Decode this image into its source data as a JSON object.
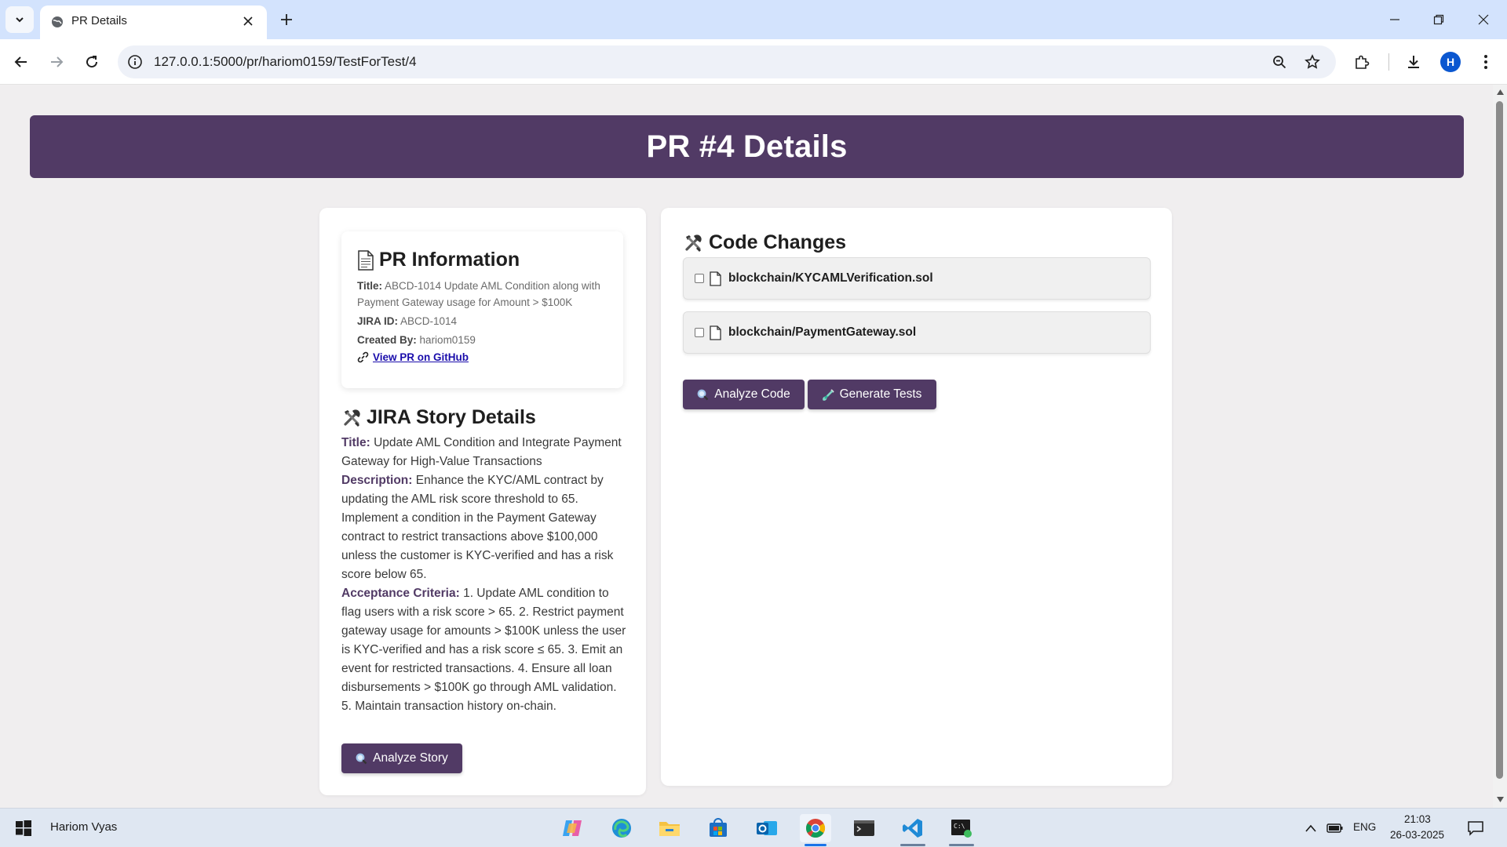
{
  "browser": {
    "tab_title": "PR Details",
    "url": "127.0.0.1:5000/pr/hariom0159/TestForTest/4",
    "profile_initial": "H"
  },
  "page": {
    "heading": "PR #4 Details",
    "pr_info": {
      "heading": "PR Information",
      "title_label": "Title:",
      "title_value": "ABCD-1014 Update AML Condition along with Payment Gateway usage for Amount > $100K",
      "jira_label": "JIRA ID:",
      "jira_value": "ABCD-1014",
      "created_label": "Created By:",
      "created_value": "hariom0159",
      "github_link": "View PR on GitHub"
    },
    "jira_story": {
      "heading": "JIRA Story Details",
      "title_label": "Title:",
      "title_value": "Update AML Condition and Integrate Payment Gateway for High-Value Transactions",
      "description_label": "Description:",
      "description_value": "Enhance the KYC/AML contract by updating the AML risk score threshold to 65. Implement a condition in the Payment Gateway contract to restrict transactions above $100,000 unless the customer is KYC-verified and has a risk score below 65.",
      "criteria_label": "Acceptance Criteria:",
      "criteria_value": "1. Update AML condition to flag users with a risk score > 65. 2. Restrict payment gateway usage for amounts > $100K unless the user is KYC-verified and has a risk score ≤ 65. 3. Emit an event for restricted transactions. 4. Ensure all loan disbursements > $100K go through AML validation. 5. Maintain transaction history on-chain.",
      "analyze_button": "Analyze Story"
    },
    "code_changes": {
      "heading": "Code Changes",
      "files": [
        {
          "name": "blockchain/KYCAMLVerification.sol",
          "checked": false
        },
        {
          "name": "blockchain/PaymentGateway.sol",
          "checked": false
        }
      ],
      "analyze_button": "Analyze Code",
      "generate_button": "Generate Tests"
    }
  },
  "taskbar": {
    "user": "Hariom Vyas",
    "language": "ENG",
    "time": "21:03",
    "date": "26-03-2025"
  },
  "colors": {
    "accent": "#513a65",
    "background": "#f0eeef"
  }
}
